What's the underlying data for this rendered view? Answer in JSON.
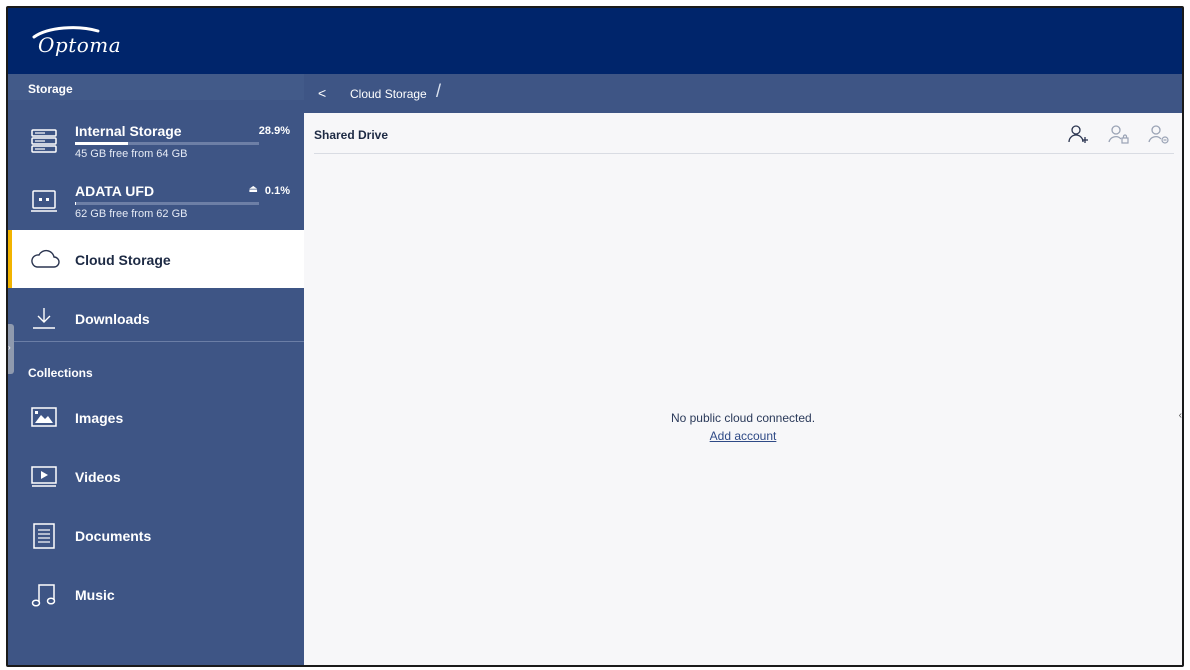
{
  "brand": {
    "logo_text": "Optoma",
    "colors": {
      "topbar": "#00256b",
      "sidebar": "#3e5585",
      "accent": "#f2b400"
    }
  },
  "sidebar": {
    "storage_label": "Storage",
    "storage": [
      {
        "name": "Internal Storage",
        "percent": "28.9%",
        "free": "45 GB free from 64 GB",
        "fill": 0.289,
        "icon": "server-icon"
      },
      {
        "name": "ADATA UFD",
        "percent": "0.1%",
        "free": "62 GB free from 62 GB",
        "fill": 0.001,
        "icon": "usb-drive-icon",
        "eject": "⏏"
      }
    ],
    "items": [
      {
        "label": "Cloud Storage",
        "icon": "cloud-icon",
        "selected": true
      },
      {
        "label": "Downloads",
        "icon": "download-icon"
      }
    ],
    "collections_label": "Collections",
    "collections": [
      {
        "label": "Images",
        "icon": "image-icon"
      },
      {
        "label": "Videos",
        "icon": "video-icon"
      },
      {
        "label": "Documents",
        "icon": "document-icon"
      },
      {
        "label": "Music",
        "icon": "music-icon"
      }
    ]
  },
  "breadcrumb": {
    "back": "<",
    "current": "Cloud Storage",
    "separator": "/"
  },
  "main": {
    "subheader_title": "Shared Drive",
    "actions": [
      "add-user-icon",
      "lock-user-icon",
      "remove-user-icon"
    ],
    "empty_message": "No public cloud connected.",
    "add_account": "Add account"
  }
}
